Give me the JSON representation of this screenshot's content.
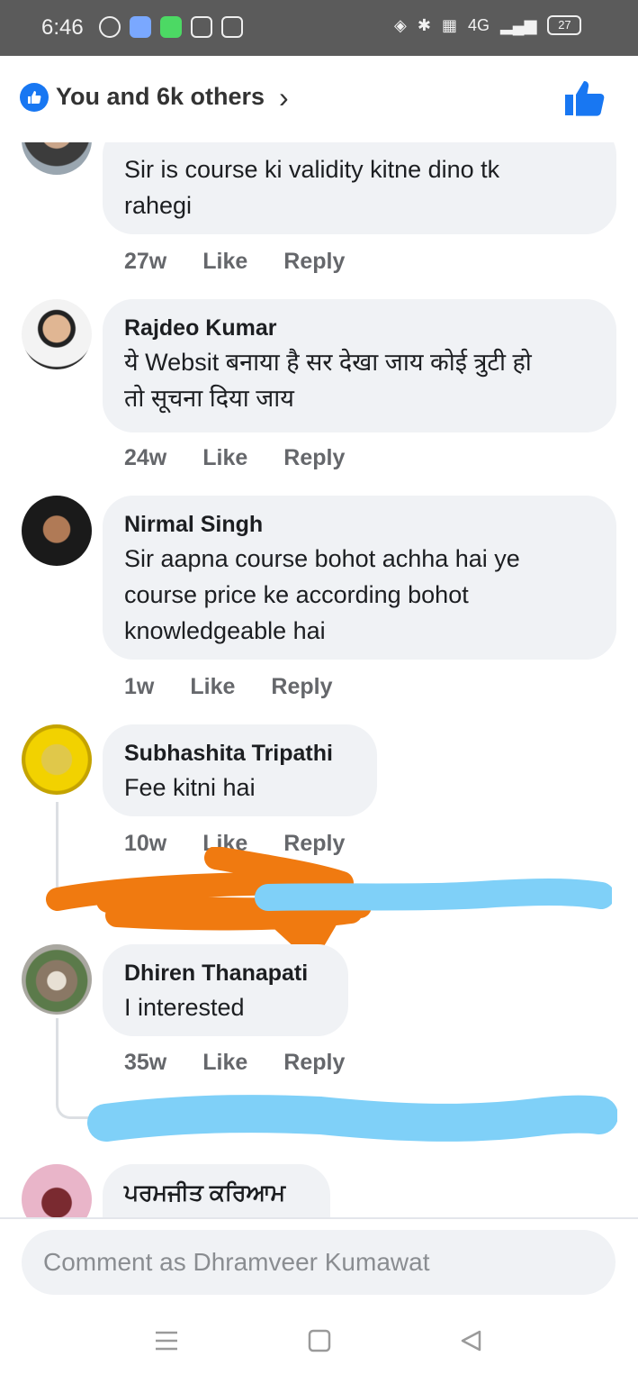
{
  "status": {
    "time": "6:46",
    "battery": "27",
    "signal_text": "4G"
  },
  "reactions": {
    "summary": "You and 6k others"
  },
  "comments": [
    {
      "name": "",
      "text_lines": [
        "Sir is course ki validity kitne dino tk",
        "rahegi"
      ],
      "age": "27w",
      "like": "Like",
      "reply": "Reply"
    },
    {
      "name": "Rajdeo Kumar",
      "text_lines": [
        "ये Websit बनाया है सर देखा जाय कोई त्रुटी हो",
        "तो सूचना दिया जाय"
      ],
      "age": "24w",
      "like": "Like",
      "reply": "Reply"
    },
    {
      "name": "Nirmal Singh",
      "text_lines": [
        "Sir aapna course bohot achha hai ye",
        "course price ke according bohot",
        "knowledgeable hai"
      ],
      "age": "1w",
      "like": "Like",
      "reply": "Reply"
    },
    {
      "name": "Subhashita Tripathi",
      "text_lines": [
        "Fee kitni hai"
      ],
      "age": "10w",
      "like": "Like",
      "reply": "Reply"
    },
    {
      "name": "Dhiren Thanapati",
      "text_lines": [
        "I interested"
      ],
      "age": "35w",
      "like": "Like",
      "reply": "Reply"
    },
    {
      "name": "ਪਰਮਜੀਤ ਕਰਿਆਮ",
      "text_lines": []
    }
  ],
  "composer": {
    "placeholder": "Comment as Dhramveer Kumawat"
  },
  "colors": {
    "facebook_blue": "#1877f2",
    "bubble": "#f0f2f5",
    "scribble_orange": "#f07a10",
    "scribble_blue": "#7fd0f8"
  },
  "icons": [
    "like-reaction-icon",
    "chevron-right-icon",
    "thumbs-up-icon",
    "menu-icon",
    "home-square-icon",
    "back-triangle-icon"
  ]
}
